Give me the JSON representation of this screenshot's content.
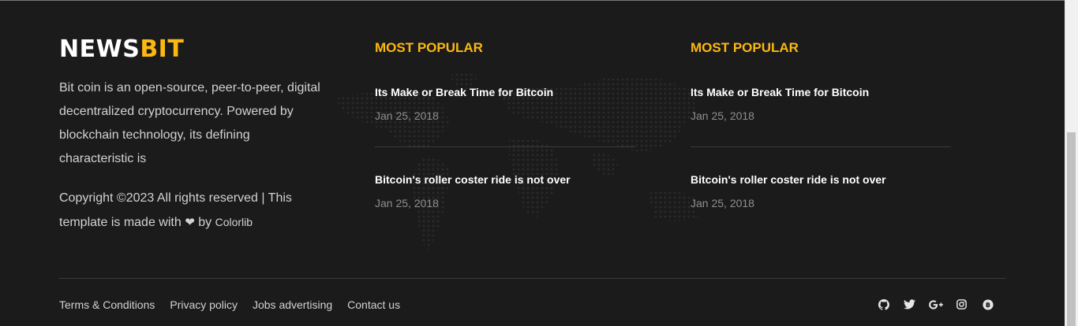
{
  "brand": {
    "part1": "NEWS",
    "part2": "BIT",
    "accent_color": "#fbb812"
  },
  "about_text": "Bit coin is an open-source, peer-to-peer, digital decentralized cryptocurrency. Powered by blockchain technology, its defining characteristic is",
  "copyright": {
    "text": "Copyright ©2023 All rights reserved | This template is made with",
    "by": "by",
    "credit": "Colorlib",
    "heart_icon": "heart-icon"
  },
  "columns": [
    {
      "title": "MOST POPULAR",
      "posts": [
        {
          "title": "Its Make or Break Time for Bitcoin",
          "date": "Jan 25, 2018"
        },
        {
          "title": "Bitcoin's roller coster ride is not over",
          "date": "Jan 25, 2018"
        }
      ]
    },
    {
      "title": "MOST POPULAR",
      "posts": [
        {
          "title": "Its Make or Break Time for Bitcoin",
          "date": "Jan 25, 2018"
        },
        {
          "title": "Bitcoin's roller coster ride is not over",
          "date": "Jan 25, 2018"
        }
      ]
    }
  ],
  "bottom_links": [
    "Terms & Conditions",
    "Privacy policy",
    "Jobs advertising",
    "Contact us"
  ],
  "social_icons": [
    "github-icon",
    "twitter-icon",
    "google-plus-icon",
    "instagram-icon",
    "bitcoin-icon"
  ]
}
